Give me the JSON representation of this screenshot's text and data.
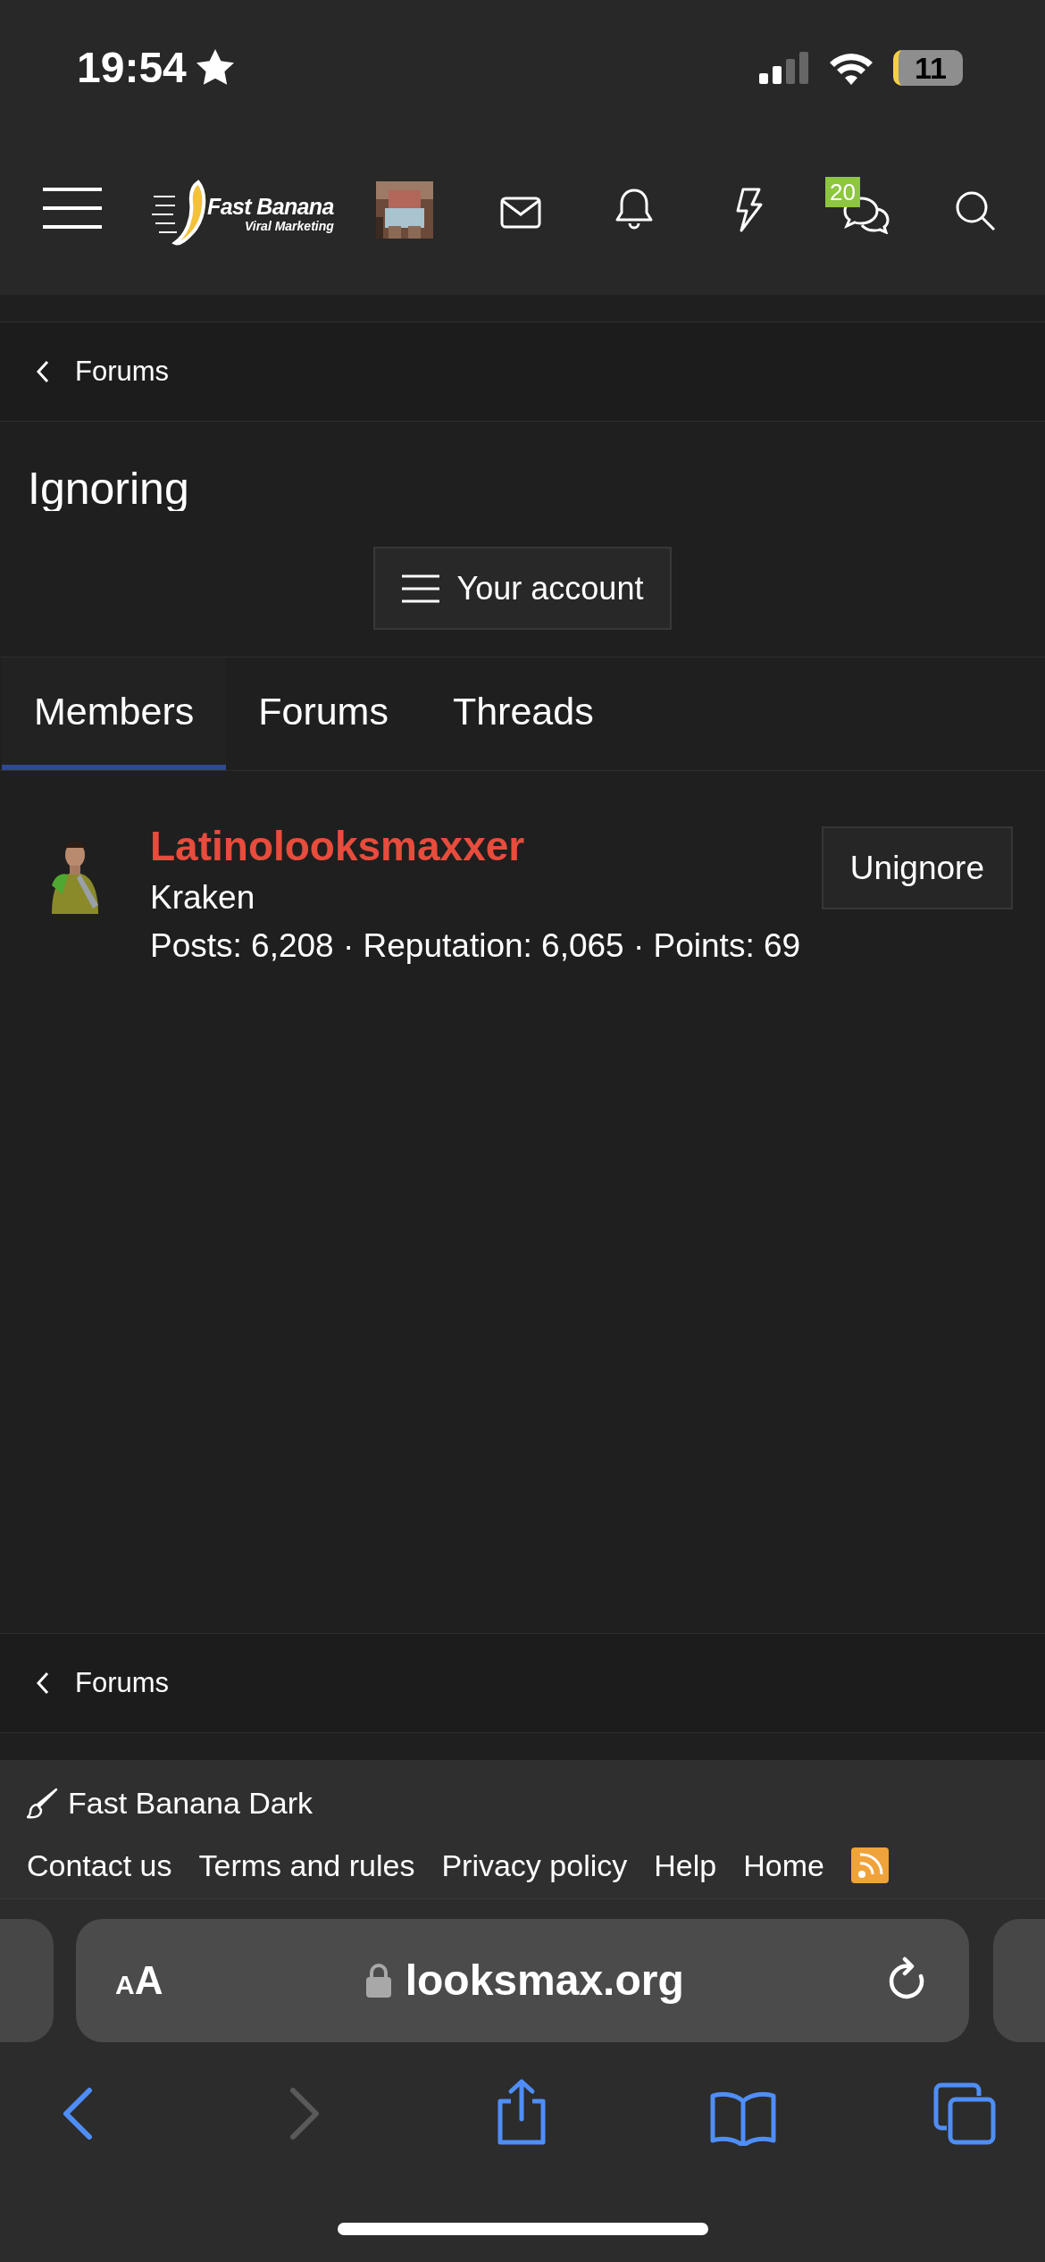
{
  "status_bar": {
    "time": "19:54",
    "battery": "11"
  },
  "nav": {
    "logo_title": "Fast Banana",
    "logo_subtitle": "Viral Marketing",
    "conversations_badge": "20"
  },
  "breadcrumb_top": {
    "label": "Forums"
  },
  "page_title": "Ignoring",
  "account_button": "Your account",
  "tabs": [
    {
      "label": "Members",
      "selected": true
    },
    {
      "label": "Forums",
      "selected": false
    },
    {
      "label": "Threads",
      "selected": false
    }
  ],
  "members": [
    {
      "name": "Latinolooksmaxxer",
      "title": "Kraken",
      "stats": "Posts: 6,208 · Reputation: 6,065 · Points: 69",
      "button": "Unignore"
    }
  ],
  "breadcrumb_bottom": {
    "label": "Forums"
  },
  "footer": {
    "style_chooser": "Fast Banana Dark",
    "links": [
      "Contact us",
      "Terms and rules",
      "Privacy policy",
      "Help",
      "Home"
    ]
  },
  "browser": {
    "text_size": "AA",
    "url": "looksmax.org"
  }
}
